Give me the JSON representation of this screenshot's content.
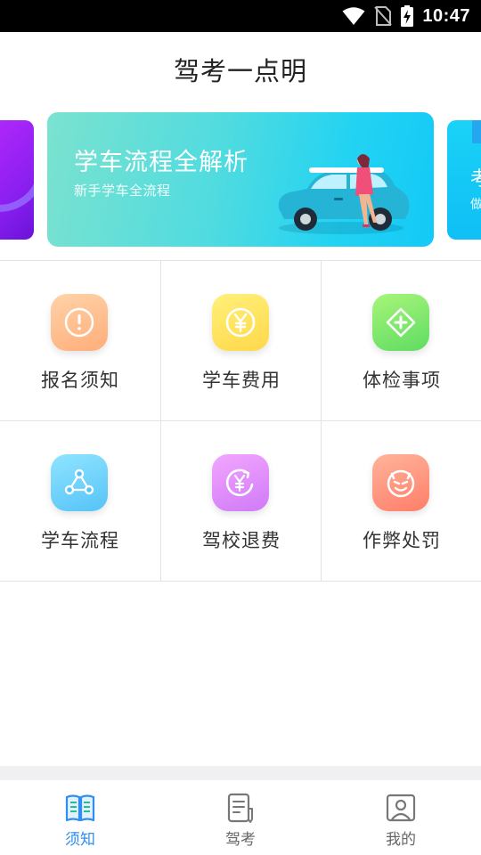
{
  "status_bar": {
    "time": "10:47",
    "icons": [
      "wifi-icon",
      "no-sim-icon",
      "battery-charging-icon"
    ]
  },
  "header": {
    "title": "驾考一点明"
  },
  "carousel": {
    "slides": [
      {
        "title": "",
        "subtitle": "",
        "color": "#b328ff"
      },
      {
        "title": "学车流程全解析",
        "subtitle": "新手学车全流程",
        "color": "#2ed6ee"
      },
      {
        "title": "考",
        "subtitle": "做",
        "color": "#15c8f6"
      }
    ],
    "active_index": 1
  },
  "grid": {
    "items": [
      {
        "label": "报名须知",
        "icon": "exclamation-icon",
        "color": "#ffb98a"
      },
      {
        "label": "学车费用",
        "icon": "yen-icon",
        "color": "#ffe05a"
      },
      {
        "label": "体检事项",
        "icon": "medical-cross-icon",
        "color": "#78e56a"
      },
      {
        "label": "学车流程",
        "icon": "process-nodes-icon",
        "color": "#6fd0fa"
      },
      {
        "label": "驾校退费",
        "icon": "refund-icon",
        "color": "#e08cfa"
      },
      {
        "label": "作弊处罚",
        "icon": "devil-face-icon",
        "color": "#ff8f78"
      }
    ]
  },
  "bottom_nav": {
    "items": [
      {
        "label": "须知",
        "icon": "open-book-icon",
        "active": true
      },
      {
        "label": "驾考",
        "icon": "exam-paper-icon",
        "active": false
      },
      {
        "label": "我的",
        "icon": "profile-icon",
        "active": false
      }
    ],
    "active_color": "#2f8ef0",
    "inactive_color": "#666666"
  }
}
